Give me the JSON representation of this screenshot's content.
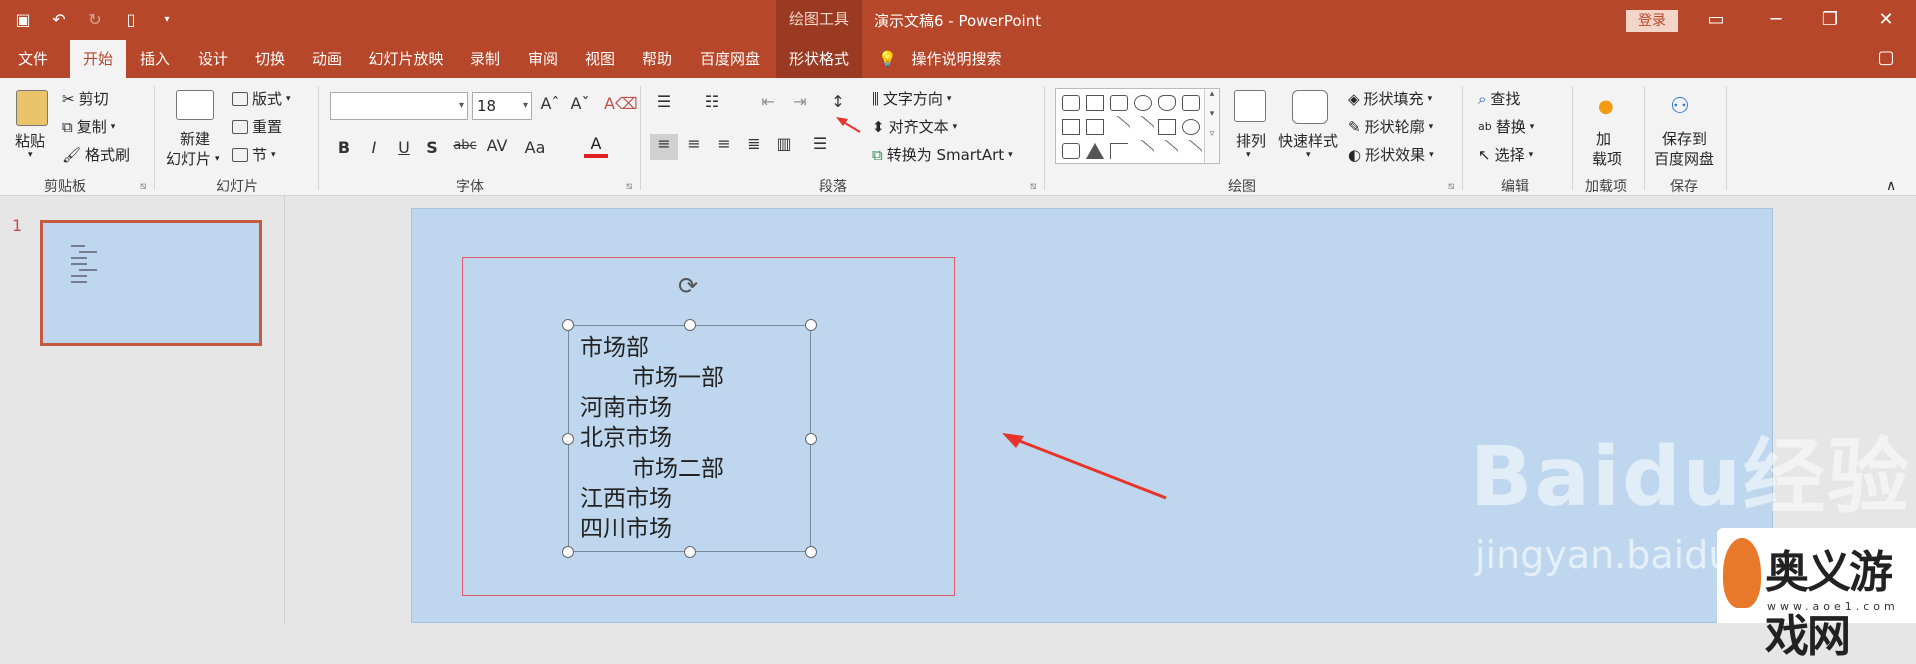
{
  "title_bar": {
    "context_tool": "绘图工具",
    "document_title": "演示文稿6  -  PowerPoint",
    "login": "登录"
  },
  "tabs": [
    "文件",
    "开始",
    "插入",
    "设计",
    "切换",
    "动画",
    "幻灯片放映",
    "录制",
    "审阅",
    "视图",
    "帮助",
    "百度网盘",
    "形状格式"
  ],
  "tell_me": "操作说明搜索",
  "ribbon": {
    "clipboard": {
      "paste": "粘贴",
      "cut": "剪切",
      "copy": "复制",
      "format_painter": "格式刷",
      "label": "剪贴板"
    },
    "slides": {
      "new_slide_1": "新建",
      "new_slide_2": "幻灯片",
      "layout": "版式",
      "reset": "重置",
      "section": "节",
      "label": "幻灯片"
    },
    "font": {
      "font_name": "",
      "font_size": "18",
      "bold": "B",
      "italic": "I",
      "underline": "U",
      "shadow": "S",
      "strike": "abc",
      "spacing": "AV",
      "case": "Aa",
      "color": "A",
      "label": "字体"
    },
    "paragraph": {
      "text_direction": "文字方向",
      "align_text": "对齐文本",
      "smartart": "转换为 SmartArt",
      "label": "段落"
    },
    "drawing": {
      "arrange": "排列",
      "quick_styles": "快速样式",
      "shape_fill": "形状填充",
      "shape_outline": "形状轮廓",
      "shape_effects": "形状效果",
      "label": "绘图"
    },
    "editing": {
      "find": "查找",
      "replace": "替换",
      "select": "选择",
      "label": "编辑"
    },
    "addins": {
      "addin_1": "加",
      "addin_2": "载项",
      "label": "加载项"
    },
    "save": {
      "save_1": "保存到",
      "save_2": "百度网盘",
      "label": "保存"
    }
  },
  "thumbnail": {
    "slide_number": "1"
  },
  "textbox_lines": [
    {
      "text": "市场部",
      "indent": 0
    },
    {
      "text": "市场一部",
      "indent": 1
    },
    {
      "text": "河南市场",
      "indent": 0
    },
    {
      "text": "北京市场",
      "indent": 0
    },
    {
      "text": "市场二部",
      "indent": 1
    },
    {
      "text": "江西市场",
      "indent": 0
    },
    {
      "text": "四川市场",
      "indent": 0
    }
  ],
  "watermark": {
    "baidu": "Baidu经验",
    "jingyan": "jingyan.baidu",
    "site_logo": "奥义游戏网",
    "site_url": "www.aoe1.com"
  }
}
